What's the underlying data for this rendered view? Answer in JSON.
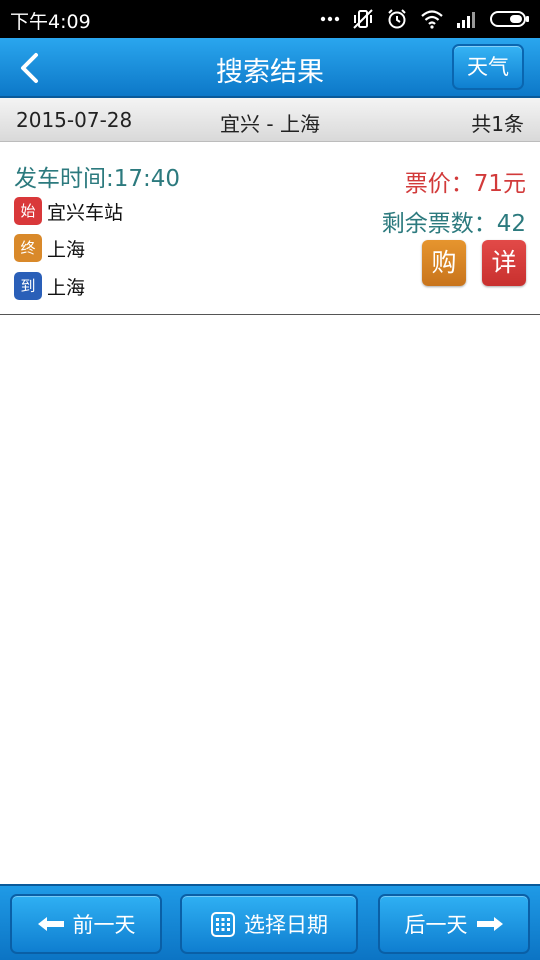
{
  "status_bar": {
    "time": "下午4:09",
    "icons": [
      "more-dots-icon",
      "vibrate-off-icon",
      "alarm-icon",
      "wifi-icon",
      "signal-icon",
      "battery-icon"
    ]
  },
  "header": {
    "title": "搜索结果",
    "back_icon": "chevron-left-icon",
    "weather_label": "天气"
  },
  "info_bar": {
    "date": "2015-07-28",
    "route": "宜兴 - 上海",
    "count": "共1条"
  },
  "results": [
    {
      "depart_time": "发车时间:17:40",
      "start_tag": "始",
      "start_station": "宜兴车站",
      "end_tag": "终",
      "end_station": "上海",
      "arrive_tag": "到",
      "arrive_station": "上海",
      "price": "票价：71元",
      "remaining": "剩余票数：42",
      "buy_label": "购",
      "detail_label": "详"
    }
  ],
  "footer": {
    "prev_label": "前一天",
    "select_date_label": "选择日期",
    "next_label": "后一天"
  },
  "colors": {
    "header_blue": "#1a8fdf",
    "start_tag": "#d9383a",
    "end_tag": "#d9892a",
    "arrive_tag": "#2a5fb8",
    "price": "#d23a3a",
    "teal_text": "#2c7a7e",
    "buy_button": "#d8862a",
    "detail_button": "#d83c3a"
  }
}
